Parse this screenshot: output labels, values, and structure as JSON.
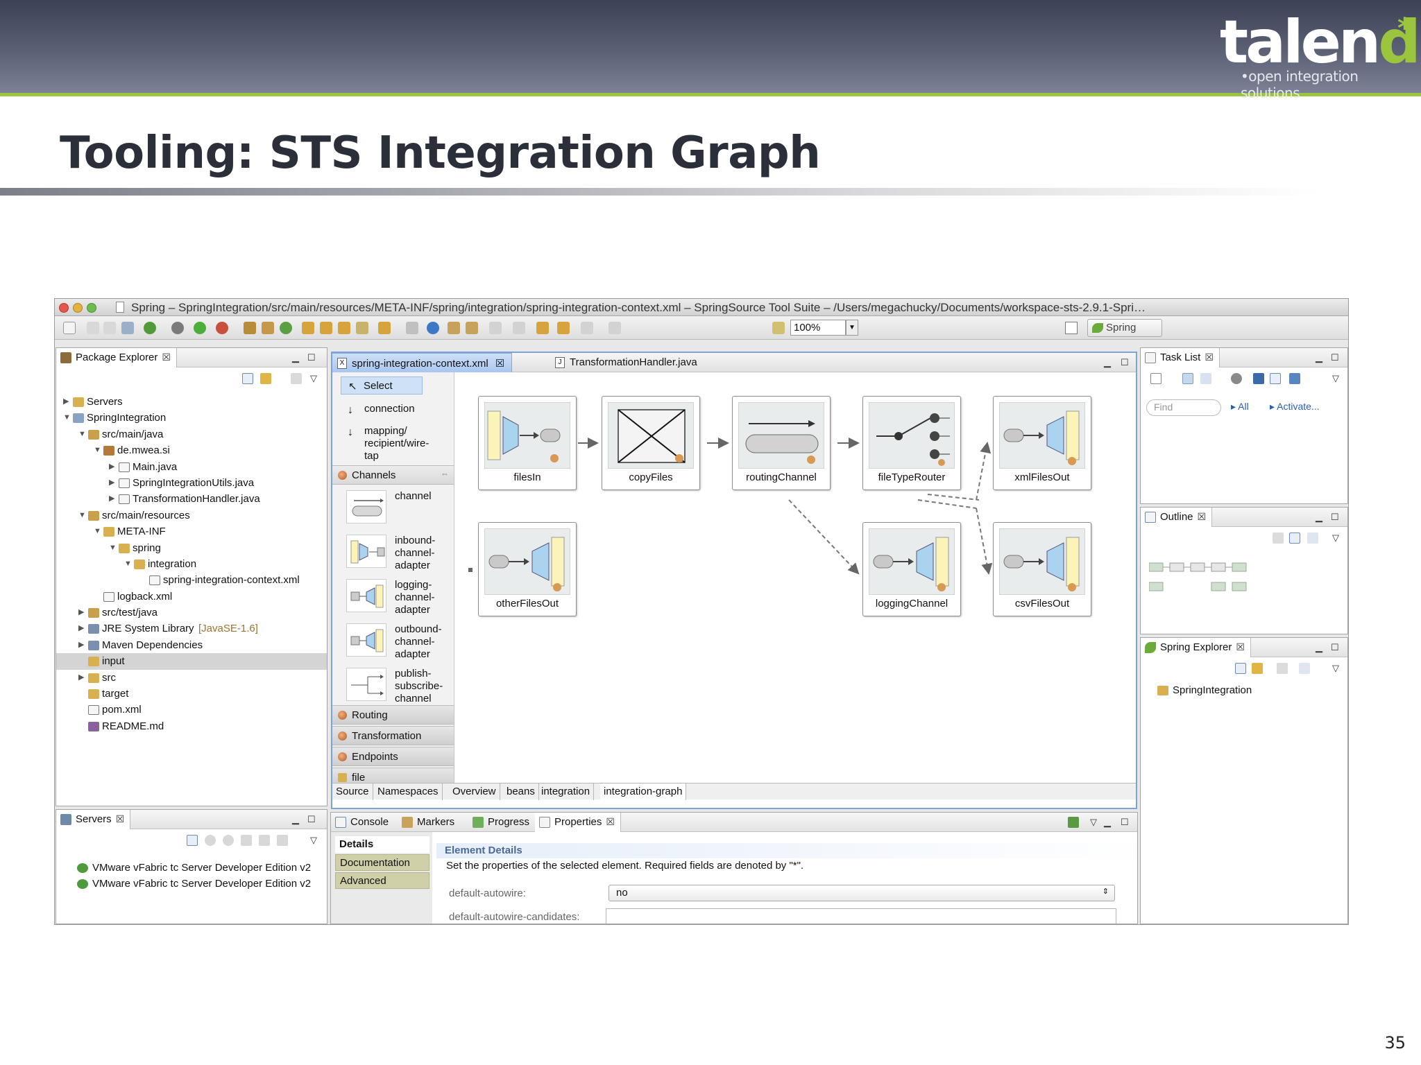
{
  "slide": {
    "brand_word": "talen",
    "brand_d": "d",
    "brand_star": "*",
    "brand_tagline": "•open integration solutions",
    "title": "Tooling: STS Integration Graph",
    "page_number": "35"
  },
  "window": {
    "title": "Spring – SpringIntegration/src/main/resources/META-INF/spring/integration/spring-integration-context.xml – SpringSource Tool Suite – /Users/megachucky/Documents/workspace-sts-2.9.1-Spri…",
    "zoom": "100%",
    "perspective": "Spring"
  },
  "package_explorer": {
    "tab": "Package Explorer",
    "tree": [
      {
        "label": "Servers",
        "level": 0,
        "toggle": "▶",
        "icon": "folder-icon"
      },
      {
        "label": "SpringIntegration",
        "level": 0,
        "toggle": "▼",
        "icon": "project-icon"
      },
      {
        "label": "src/main/java",
        "level": 1,
        "toggle": "▼",
        "icon": "source-folder-icon"
      },
      {
        "label": "de.mwea.si",
        "level": 2,
        "toggle": "▼",
        "icon": "package-icon"
      },
      {
        "label": "Main.java",
        "level": 3,
        "toggle": "▶",
        "icon": "java-file-icon"
      },
      {
        "label": "SpringIntegrationUtils.java",
        "level": 3,
        "toggle": "▶",
        "icon": "java-file-icon"
      },
      {
        "label": "TransformationHandler.java",
        "level": 3,
        "toggle": "▶",
        "icon": "java-file-icon"
      },
      {
        "label": "src/main/resources",
        "level": 1,
        "toggle": "▼",
        "icon": "source-folder-icon"
      },
      {
        "label": "META-INF",
        "level": 2,
        "toggle": "▼",
        "icon": "folder-icon"
      },
      {
        "label": "spring",
        "level": 3,
        "toggle": "▼",
        "icon": "folder-icon"
      },
      {
        "label": "integration",
        "level": 4,
        "toggle": "▼",
        "icon": "folder-icon"
      },
      {
        "label": "spring-integration-context.xml",
        "level": 5,
        "toggle": "",
        "icon": "xml-file-icon"
      },
      {
        "label": "logback.xml",
        "level": 2,
        "toggle": "",
        "icon": "xml-file-icon"
      },
      {
        "label": "src/test/java",
        "level": 1,
        "toggle": "▶",
        "icon": "source-folder-icon"
      },
      {
        "label": "JRE System Library",
        "deco": "[JavaSE-1.6]",
        "level": 1,
        "toggle": "▶",
        "icon": "library-icon"
      },
      {
        "label": "Maven Dependencies",
        "level": 1,
        "toggle": "▶",
        "icon": "library-icon"
      },
      {
        "label": "input",
        "level": 1,
        "toggle": "",
        "icon": "folder-icon",
        "selected": true
      },
      {
        "label": "src",
        "level": 1,
        "toggle": "▶",
        "icon": "folder-icon"
      },
      {
        "label": "target",
        "level": 1,
        "toggle": "",
        "icon": "folder-icon"
      },
      {
        "label": "pom.xml",
        "level": 1,
        "toggle": "",
        "icon": "maven-file-icon"
      },
      {
        "label": "README.md",
        "level": 1,
        "toggle": "",
        "icon": "markdown-file-icon"
      }
    ]
  },
  "servers_view": {
    "tab": "Servers",
    "items": [
      "VMware vFabric tc Server Developer Edition v2",
      "VMware vFabric tc Server Developer Edition v2"
    ]
  },
  "editor": {
    "tabs": [
      "spring-integration-context.xml",
      "TransformationHandler.java"
    ],
    "palette": {
      "select": "Select",
      "connection": "connection",
      "mapping": "mapping/\nrecipient/wire-\ntap",
      "channels_drawer": "Channels",
      "tools": [
        "channel",
        "inbound-\nchannel-\nadapter",
        "logging-\nchannel-\nadapter",
        "outbound-\nchannel-\nadapter",
        "publish-\nsubscribe-\nchannel"
      ],
      "drawers": [
        "Routing",
        "Transformation",
        "Endpoints",
        "file"
      ]
    },
    "nodes": [
      "filesIn",
      "copyFiles",
      "routingChannel",
      "fileTypeRouter",
      "xmlFilesOut",
      "otherFilesOut",
      "loggingChannel",
      "csvFilesOut"
    ],
    "bottom_tabs": [
      "Source",
      "Namespaces",
      "Overview",
      "beans",
      "integration",
      "integration-graph"
    ]
  },
  "task_list": {
    "tab": "Task List",
    "find_placeholder": "Find",
    "all": "All",
    "activate": "Activate..."
  },
  "outline": {
    "tab": "Outline"
  },
  "spring_explorer": {
    "tab": "Spring Explorer",
    "item": "SpringIntegration"
  },
  "properties": {
    "tabs": [
      "Console",
      "Markers",
      "Progress",
      "Properties"
    ],
    "nav": [
      "Details",
      "Documentation",
      "Advanced"
    ],
    "section": "Element Details",
    "description": "Set the properties of the selected element. Required fields are denoted by \"*\".",
    "fields": [
      {
        "label": "default-autowire:",
        "value": "no"
      },
      {
        "label": "default-autowire-candidates:",
        "value": ""
      }
    ]
  },
  "colors": {
    "accent_green": "#9bc53d",
    "header_dark": "#3c4156",
    "editor_border": "#7da3d6",
    "selection_blue": "#cfe1f7"
  }
}
